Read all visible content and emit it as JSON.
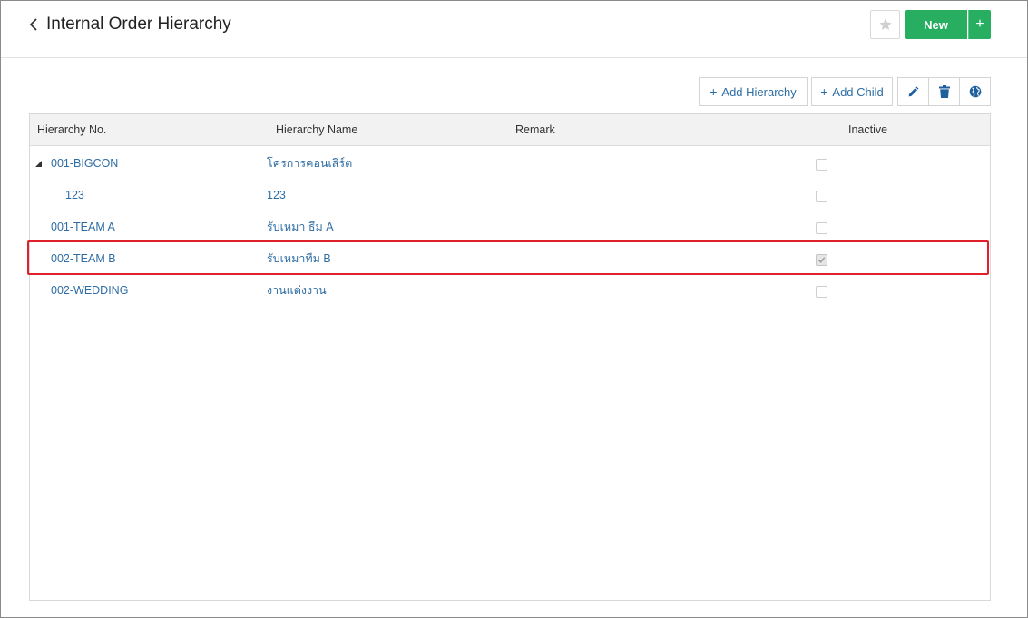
{
  "header": {
    "title": "Internal Order Hierarchy",
    "new_label": "New",
    "new_plus_label": "+"
  },
  "toolbar": {
    "add_hierarchy_label": "Add Hierarchy",
    "add_child_label": "Add Child",
    "plus_symbol": "+"
  },
  "table": {
    "columns": [
      "Hierarchy No.",
      "Hierarchy Name",
      "Remark",
      "Inactive"
    ],
    "rows": [
      {
        "no": "001-BIGCON",
        "name": "โครการคอนเสิร์ต",
        "remark": "",
        "inactive": false
      },
      {
        "no": "123",
        "name": "123",
        "remark": "",
        "inactive": false
      },
      {
        "no": "001-TEAM A",
        "name": "รับเหมา ธีม A",
        "remark": "",
        "inactive": false
      },
      {
        "no": "002-TEAM B",
        "name": "รับเหมาทีม B",
        "remark": "",
        "inactive": true
      },
      {
        "no": "002-WEDDING",
        "name": "งานแต่งงาน",
        "remark": "",
        "inactive": false
      }
    ]
  },
  "colors": {
    "accent_green": "#27ae60",
    "link_blue": "#2e6da4",
    "highlight_red": "#e0202a"
  },
  "icons": {
    "back": "chevron-left-icon",
    "favorite": "star-icon",
    "edit": "pencil-icon",
    "delete": "trash-icon",
    "language": "globe-icon",
    "expand": "triangle-expanded-icon"
  }
}
